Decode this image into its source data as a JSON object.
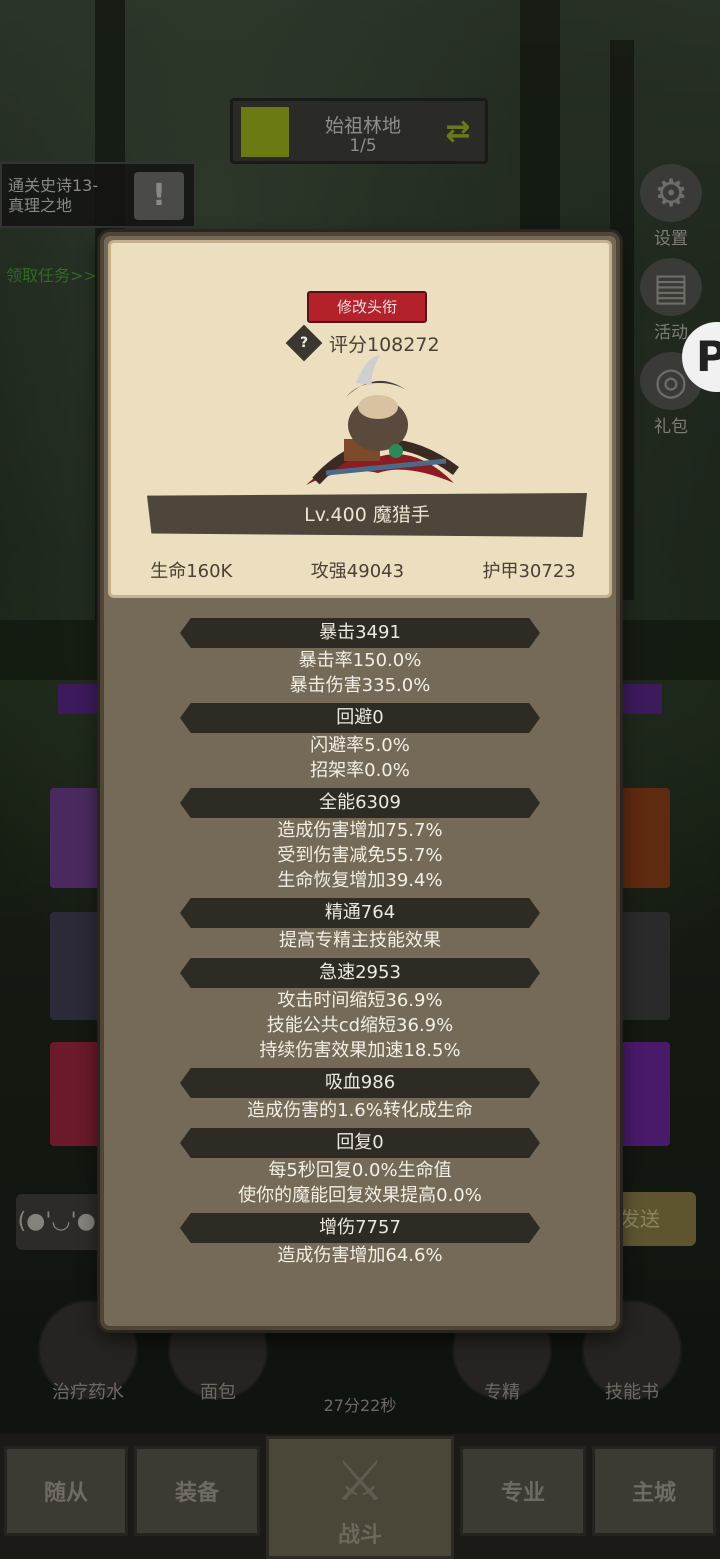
{
  "stage": {
    "name": "始祖林地",
    "progress": "1/5"
  },
  "quest": {
    "title_line1": "通关史诗13-",
    "title_line2": "真理之地",
    "claim_link": "领取任务>>"
  },
  "side_menu": [
    {
      "label": "设置",
      "icon": "gear-icon"
    },
    {
      "label": "活动",
      "icon": "scroll-icon"
    },
    {
      "label": "礼包",
      "icon": "gift-icon"
    }
  ],
  "floating_badge": "P",
  "chat": {
    "emote": "(●'◡'●)",
    "send_label": "发送"
  },
  "tools": [
    {
      "label": "治疗药水"
    },
    {
      "label": "面包"
    },
    {
      "label": "专精"
    },
    {
      "label": "技能书"
    }
  ],
  "timer": "27分22秒",
  "nav": {
    "companion": "随从",
    "equipment": "装备",
    "battle": "战斗",
    "profession": "专业",
    "city": "主城"
  },
  "hero": {
    "change_title_label": "修改头衔",
    "help_symbol": "?",
    "score": "评分108272",
    "name": "Lv.400 魔猎手",
    "hp": "生命160K",
    "attack": "攻强49043",
    "armor": "护甲30723"
  },
  "attributes": [
    {
      "header": "暴击3491",
      "lines": [
        "暴击率150.0%",
        "暴击伤害335.0%"
      ]
    },
    {
      "header": "回避0",
      "lines": [
        "闪避率5.0%",
        "招架率0.0%"
      ]
    },
    {
      "header": "全能6309",
      "lines": [
        "造成伤害增加75.7%",
        "受到伤害减免55.7%",
        "生命恢复增加39.4%"
      ]
    },
    {
      "header": "精通764",
      "lines": [
        "提高专精主技能效果"
      ]
    },
    {
      "header": "急速2953",
      "lines": [
        "攻击时间缩短36.9%",
        "技能公共cd缩短36.9%",
        "持续伤害效果加速18.5%"
      ]
    },
    {
      "header": "吸血986",
      "lines": [
        "造成伤害的1.6%转化成生命"
      ]
    },
    {
      "header": "回复0",
      "lines": [
        "每5秒回复0.0%生命值",
        "使你的魔能回复效果提高0.0%"
      ]
    },
    {
      "header": "增伤7757",
      "lines": [
        "造成伤害增加64.6%"
      ]
    }
  ]
}
